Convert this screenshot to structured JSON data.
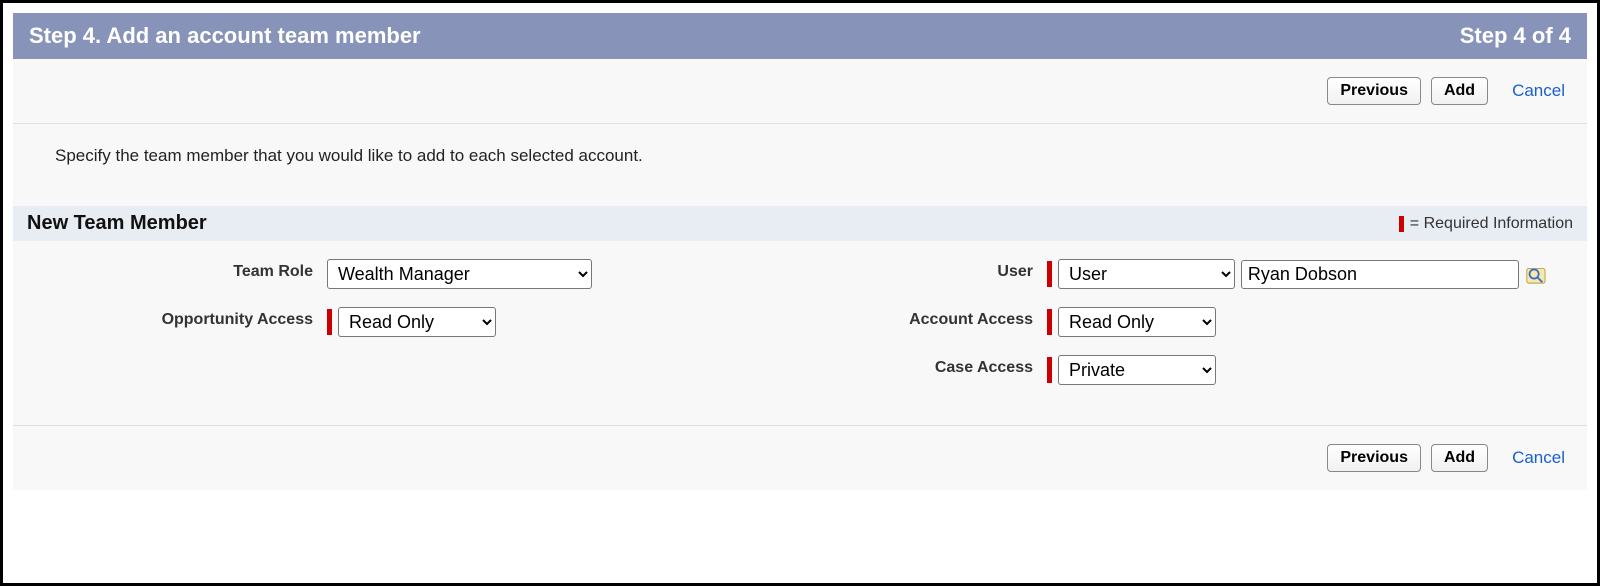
{
  "header": {
    "title": "Step 4. Add an account team member",
    "step_indicator": "Step 4 of 4"
  },
  "buttons": {
    "previous": "Previous",
    "add": "Add",
    "cancel": "Cancel"
  },
  "instructions": "Specify the team member that you would like to add to each selected account.",
  "section": {
    "title": "New Team Member",
    "required_legend": "= Required Information"
  },
  "fields": {
    "team_role": {
      "label": "Team Role",
      "value": "Wealth Manager"
    },
    "user": {
      "label": "User",
      "type_value": "User",
      "name_value": "Ryan Dobson"
    },
    "opportunity_access": {
      "label": "Opportunity Access",
      "value": "Read Only"
    },
    "account_access": {
      "label": "Account Access",
      "value": "Read Only"
    },
    "case_access": {
      "label": "Case Access",
      "value": "Private"
    }
  }
}
